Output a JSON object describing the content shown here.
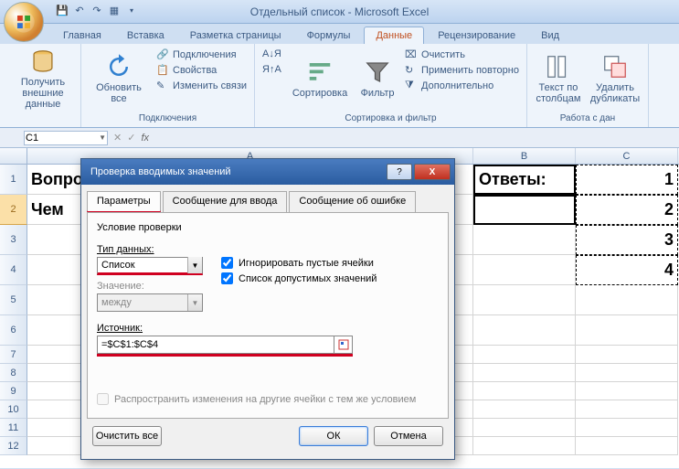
{
  "title": "Отдельный список - Microsoft Excel",
  "ribbon_tabs": {
    "home": "Главная",
    "insert": "Вставка",
    "layout": "Разметка страницы",
    "formulas": "Формулы",
    "data": "Данные",
    "review": "Рецензирование",
    "view": "Вид"
  },
  "groups": {
    "external": {
      "get": "Получить\nвнешние данные",
      "title": ""
    },
    "connections": {
      "refresh": "Обновить\nвсе",
      "conn": "Подключения",
      "props": "Свойства",
      "links": "Изменить связи",
      "title": "Подключения"
    },
    "sortfilter": {
      "az": "А↓Я",
      "za": "Я↑А",
      "sort": "Сортировка",
      "filter": "Фильтр",
      "clear": "Очистить",
      "reapply": "Применить повторно",
      "advanced": "Дополнительно",
      "title": "Сортировка и фильтр"
    },
    "tools": {
      "ttc": "Текст по\nстолбцам",
      "dup": "Удалить\nдубликаты",
      "title": "Работа с дан"
    }
  },
  "namebox": "C1",
  "fx": "fx",
  "columns": {
    "A": "A",
    "B": "B",
    "C": "C"
  },
  "cells": {
    "A1": "Вопросы",
    "B1": "Ответы:",
    "C1": "1",
    "A2": "Чем",
    "C2": "2",
    "C3": "3",
    "C4": "4"
  },
  "dialog": {
    "title": "Проверка вводимых значений",
    "help": "?",
    "close": "X",
    "tabs": {
      "params": "Параметры",
      "input": "Сообщение для ввода",
      "error": "Сообщение об ошибке"
    },
    "cond_label": "Условие проверки",
    "type_label": "Тип данных:",
    "type_value": "Список",
    "ignore": "Игнорировать пустые ячейки",
    "listvals": "Список допустимых значений",
    "value_label": "Значение:",
    "value_value": "между",
    "source_label": "Источник:",
    "source_value": "=$C$1:$C$4",
    "spread": "Распространить изменения на другие ячейки с тем же условием",
    "clear": "Очистить все",
    "ok": "ОК",
    "cancel": "Отмена"
  }
}
